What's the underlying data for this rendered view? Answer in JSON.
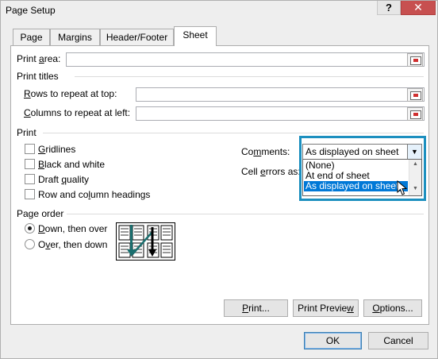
{
  "window": {
    "title": "Page Setup",
    "help_label": "?",
    "close_label": "✕"
  },
  "tabs": [
    {
      "label": "Page",
      "active": false
    },
    {
      "label": "Margins",
      "active": false
    },
    {
      "label": "Header/Footer",
      "active": false
    },
    {
      "label": "Sheet",
      "active": true
    }
  ],
  "sheet": {
    "print_area": {
      "label_pre": "Print ",
      "label_key": "a",
      "label_post": "rea:",
      "value": ""
    },
    "print_titles": {
      "heading": "Print titles",
      "rows": {
        "label_key": "R",
        "label_post": "ows to repeat at top:",
        "value": ""
      },
      "cols": {
        "label_key": "C",
        "label_post": "olumns to repeat at left:",
        "value": ""
      }
    },
    "print": {
      "heading": "Print",
      "gridlines": {
        "label_key": "G",
        "label_post": "ridlines",
        "checked": false
      },
      "black_white": {
        "label_key": "B",
        "label_post": "lack and white",
        "checked": false
      },
      "draft": {
        "label_pre": "Draft ",
        "label_key": "q",
        "label_post": "uality",
        "checked": false
      },
      "headings": {
        "label_pre": "Row and co",
        "label_key": "l",
        "label_post": "umn headings",
        "checked": false
      },
      "comments": {
        "label_pre": "Co",
        "label_key": "m",
        "label_post": "ments:",
        "value": "As displayed on sheet",
        "options": [
          "(None)",
          "At end of sheet",
          "As displayed on sheet"
        ]
      },
      "cell_errors": {
        "label_pre": "Cell ",
        "label_key": "e",
        "label_post": "rrors as:"
      }
    },
    "page_order": {
      "heading": "Page order",
      "down_over": {
        "label_key": "D",
        "label_post": "own, then over",
        "checked": true
      },
      "over_down": {
        "label_pre": "O",
        "label_key": "v",
        "label_post": "er, then down",
        "checked": false
      }
    },
    "buttons": {
      "print": {
        "label_key": "P",
        "label_post": "rint..."
      },
      "preview": {
        "label_pre": "Print Previe",
        "label_key": "w",
        "label_post": ""
      },
      "options": {
        "label_key": "O",
        "label_post": "ptions..."
      }
    }
  },
  "footer": {
    "ok": "OK",
    "cancel": "Cancel"
  },
  "colors": {
    "accent": "#1c8fbf",
    "selection": "#0078d7",
    "arrow": "#1a6e6e"
  }
}
